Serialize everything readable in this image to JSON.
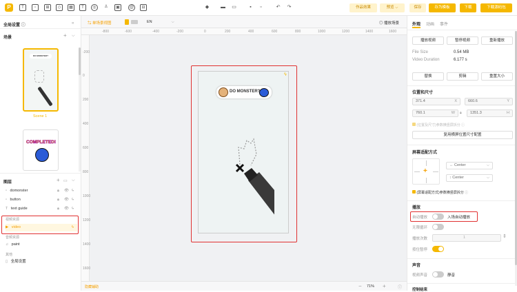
{
  "toolbar": {
    "logo": "P",
    "works_effect": "作品效果",
    "preview": "预览",
    "preview_chevron": "⌵",
    "save": "保存",
    "save_as_template": "存为模板",
    "download": "下载",
    "download_compiled": "下载源码包"
  },
  "left": {
    "global_settings": "全局设置",
    "scenes_title": "场景",
    "scene1_label": "Scene 1",
    "thumb_text": "DO MONSTER?",
    "thumb2_text": "COMPLETED!",
    "layers_title": "图层",
    "layers": [
      {
        "name": "domonster"
      },
      {
        "name": "button"
      },
      {
        "name": "text guide"
      }
    ],
    "video_group": "视频资源",
    "video_layer": "video",
    "audio_group": "音频资源",
    "audio_layer": "paint",
    "other_group": "其他",
    "global_settings_item": "全局设置"
  },
  "canvas": {
    "single_scene_label": "单场景视图",
    "language": "EN",
    "play_scene": "播放场景",
    "ruler_x": [
      "-800",
      "-600",
      "-400",
      "-200",
      "0",
      "200",
      "400",
      "600",
      "800",
      "1000",
      "1200",
      "1400",
      "1600"
    ],
    "ruler_y": [
      "-200",
      "0",
      "200",
      "400",
      "600",
      "800",
      "1000",
      "1200",
      "1400",
      "1600"
    ],
    "banner_text": "DO MONSTER?",
    "hint": "隐藏辅助",
    "zoom": "71%",
    "zoom_minus": "−",
    "zoom_plus": "+"
  },
  "right": {
    "tabs": [
      "外观",
      "动画",
      "事件"
    ],
    "btn_play": "播放视频",
    "btn_pause": "暂停视频",
    "btn_replay": "重新播放",
    "file_size_label": "File Size",
    "file_size_value": "0.54 MB",
    "duration_label": "Video Duration",
    "duration_value": "6.177 s",
    "btn_replace": "替换",
    "btn_crop": "剪辑",
    "btn_resize": "重置大小",
    "position_size_title": "位置和尺寸",
    "x_value": "371.4",
    "x_label": "X",
    "y_value": "660.6",
    "y_label": "Y",
    "w_value": "760.1",
    "w_label": "W",
    "h_value": "1351.3",
    "h_label": "H",
    "check_position_text": "(位置及尺寸)参数横竖屏拆分",
    "apply_btn": "复用横屏位置尺寸配置",
    "screen_adapt_title": "屏幕适配方式",
    "h_center": "Center",
    "v_center": "Center",
    "screen_adapt_check": "(屏幕适配方式)参数横竖屏拆分",
    "playback_title": "播放",
    "autoplay_label": "自动播放",
    "autoplay_hint": "入场自动播放",
    "loop_label": "无限循环",
    "play_count_label": "播放次数",
    "play_count_value": "1",
    "hide_control_label": "按住暂停",
    "sound_title": "声音",
    "video_sound_label": "视频声音",
    "mute_label": "静音",
    "bottom_cut_label": "控制结束"
  }
}
